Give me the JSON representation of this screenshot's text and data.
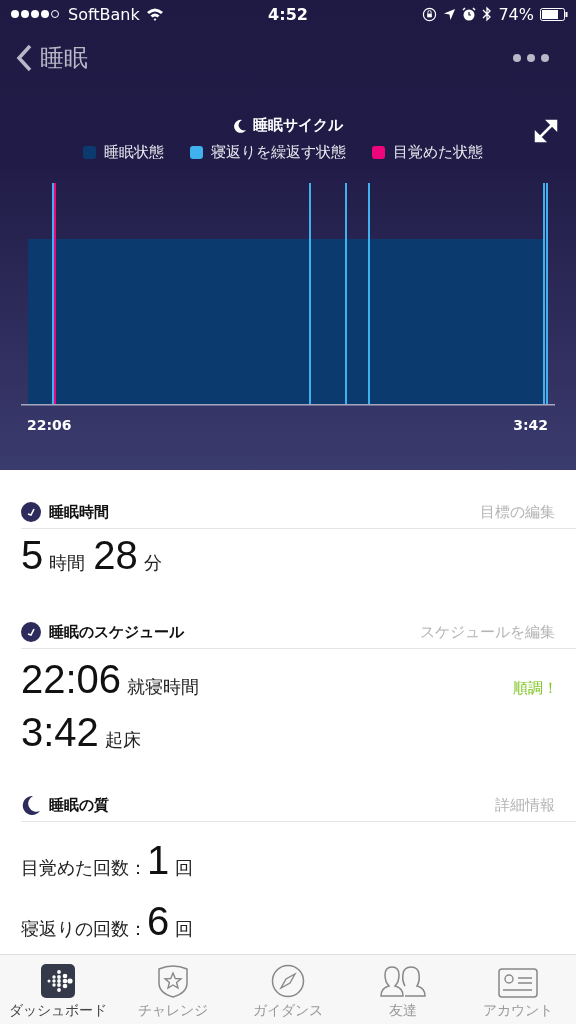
{
  "status_bar": {
    "carrier": "SoftBank",
    "time": "4:52",
    "battery": "74%"
  },
  "header": {
    "back_label": "睡眠"
  },
  "chart": {
    "title": "睡眠サイクル",
    "legend": [
      {
        "label": "睡眠状態",
        "color": "#0b3a6e"
      },
      {
        "label": "寝返りを繰返す状態",
        "color": "#3eb1ee"
      },
      {
        "label": "目覚めた状態",
        "color": "#f0067c"
      }
    ],
    "start_label": "22:06",
    "end_label": "3:42"
  },
  "sections": [
    {
      "kind": "duration",
      "title": "睡眠時間",
      "action": "目標の編集",
      "parts": [
        {
          "value": "5",
          "unit": "時間"
        },
        {
          "value": "28",
          "unit": "分"
        }
      ]
    },
    {
      "kind": "schedule",
      "title": "睡眠のスケジュール",
      "action": "スケジュールを編集",
      "rows": [
        {
          "value": "22:06",
          "label": "就寝時間",
          "status": "順調！"
        },
        {
          "value": "3:42",
          "label": "起床"
        }
      ]
    },
    {
      "kind": "quality",
      "title": "睡眠の質",
      "action": "詳細情報",
      "rows": [
        {
          "label": "目覚めた回数：",
          "value": "1",
          "unit": "回"
        },
        {
          "label": "寝返りの回数：",
          "value": "6",
          "unit": "回"
        }
      ]
    }
  ],
  "tabs": [
    {
      "label": "ダッシュボード",
      "selected": true
    },
    {
      "label": "チャレンジ",
      "selected": false
    },
    {
      "label": "ガイダンス",
      "selected": false
    },
    {
      "label": "友達",
      "selected": false
    },
    {
      "label": "アカウント",
      "selected": false
    }
  ]
}
